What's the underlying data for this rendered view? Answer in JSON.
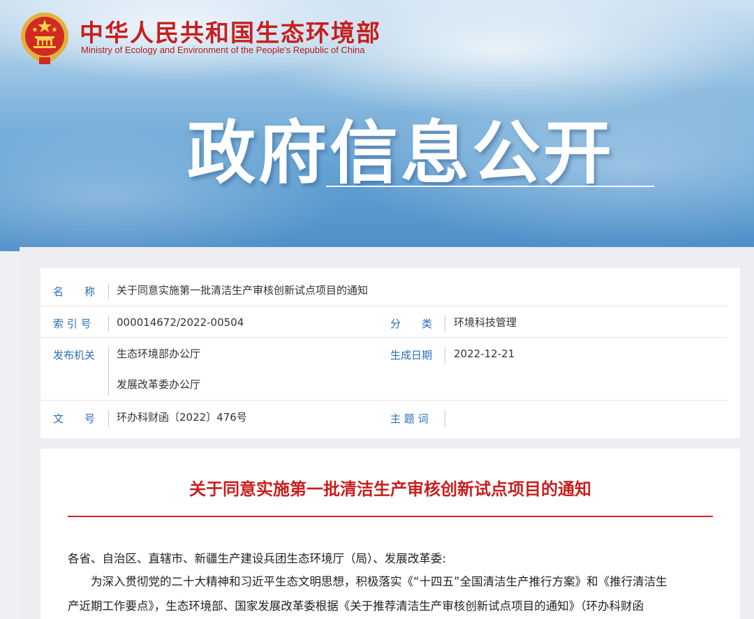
{
  "header": {
    "ministry_cn": "中华人民共和国生态环境部",
    "ministry_en": "Ministry of Ecology and Environment of the People's Republic of China",
    "emblem_icon": "national-emblem-icon",
    "banner_title": "政府信息公开"
  },
  "meta": {
    "name_label": "名　　称",
    "name_value": "关于同意实施第一批清洁生产审核创新试点项目的通知",
    "index_label": "索 引 号",
    "index_value": "000014672/2022-00504",
    "category_label": "分　　类",
    "category_value": "环境科技管理",
    "publisher_label": "发布机关",
    "publisher_value_1": "生态环境部办公厅",
    "publisher_value_2": "发展改革委办公厅",
    "date_label": "生成日期",
    "date_value": "2022-12-21",
    "docno_label": "文　　号",
    "docno_value": "环办科财函〔2022〕476号",
    "keywords_label": "主 题 词",
    "keywords_value": ""
  },
  "document": {
    "title": "关于同意实施第一批清洁生产审核创新试点项目的通知",
    "salutation": "各省、自治区、直辖市、新疆生产建设兵团生态环境厅（局）、发展改革委:",
    "para1_line1": "　　为深入贯彻党的二十大精神和习近平生态文明思想，积极落实《“十四五”全国清洁生产推行方案》和《推行清洁生",
    "para1_line2": "产近期工作要点》，生态环境部、国家发展改革委根据《关于推荐清洁生产审核创新试点项目的通知》（环办科财函"
  },
  "colors": {
    "brand_red": "#c81e1e",
    "label_blue": "#2a6cb8",
    "rule_red": "#d42323"
  }
}
